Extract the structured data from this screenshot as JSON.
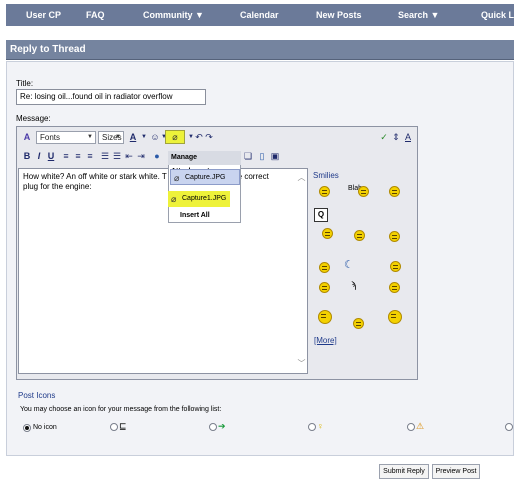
{
  "nav": {
    "items": [
      "User CP",
      "FAQ",
      "Community ▼",
      "Calendar",
      "New Posts",
      "Search ▼",
      "Quick Links"
    ]
  },
  "header": {
    "title": "Reply to Thread"
  },
  "form": {
    "title_label": "Title:",
    "title_value": "Re: losing oil...found oil in radiator overflow",
    "message_label": "Message:"
  },
  "toolbar": {
    "fonts": "Fonts",
    "sizes": "Sizes",
    "bold": "B",
    "italic": "I",
    "underline": "U"
  },
  "message_text": "How white? An off white or stark white. T",
  "message_text_tail": "s the correct",
  "message_text_line2": "plug for the engine:",
  "dropdown": {
    "header": "Manage Attachments",
    "items": [
      "Capture.JPG",
      "Capture1.JPG"
    ],
    "insert_all": "Insert All"
  },
  "smilies": {
    "title": "Smilies",
    "blah": "Blah",
    "more": "[More]"
  },
  "post_icons": {
    "title": "Post Icons",
    "hint": "You may choose an icon for your message from the following list:",
    "no_icon": "No icon"
  },
  "buttons": {
    "submit": "Submit Reply",
    "preview": "Preview Post"
  },
  "colors": {
    "nav_bg": "#6b7a99",
    "header_bg": "#75849f",
    "highlight": "#ecf23a",
    "link": "#1f3a8a"
  }
}
